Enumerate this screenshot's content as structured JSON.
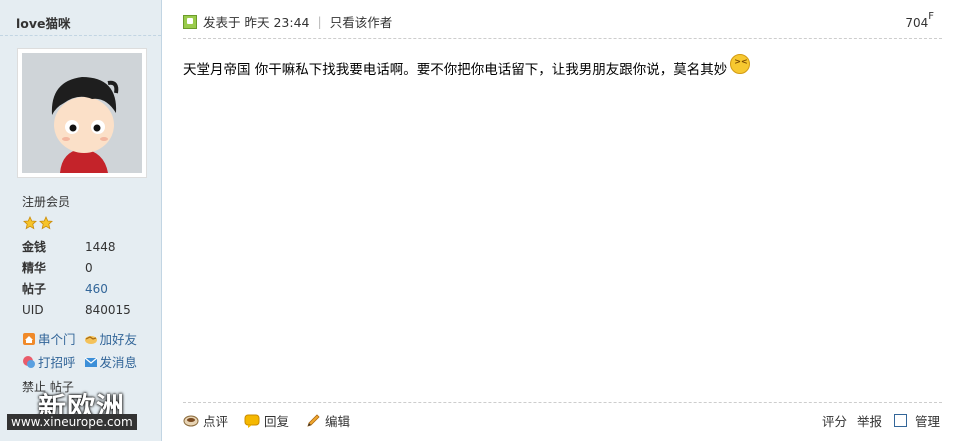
{
  "user": {
    "name": "love猫咪",
    "group": "注册会员",
    "stats": [
      {
        "label": "金钱",
        "value": "1448"
      },
      {
        "label": "精华",
        "value": "0"
      },
      {
        "label": "帖子",
        "value": "460"
      },
      {
        "label": "UID",
        "value": "840015"
      }
    ],
    "actions": [
      {
        "label": "串个门",
        "icon": "home-icon"
      },
      {
        "label": "加好友",
        "icon": "handshake-icon"
      },
      {
        "label": "打招呼",
        "icon": "wave-icon"
      },
      {
        "label": "发消息",
        "icon": "mail-icon"
      }
    ],
    "ban_text": "禁止  帖子"
  },
  "watermark": {
    "title": "新欧洲",
    "url": "www.xineurope.com"
  },
  "post": {
    "posted_label": "发表于",
    "posted_time": "昨天 23:44",
    "only_author": "只看该作者",
    "floor_number": "704",
    "floor_suffix": "F",
    "content": "天堂月帝国 你干嘛私下找我要电话啊。要不你把你电话留下，让我男朋友跟你说，莫名其妙"
  },
  "footer": {
    "comment_label": "点评",
    "reply_label": "回复",
    "edit_label": "编辑",
    "rate_label": "评分",
    "report_label": "举报",
    "manage_label": "管理"
  },
  "colors": {
    "sidebar_bg": "#e5edf2",
    "link": "#336699",
    "border": "#c2d5e3"
  }
}
